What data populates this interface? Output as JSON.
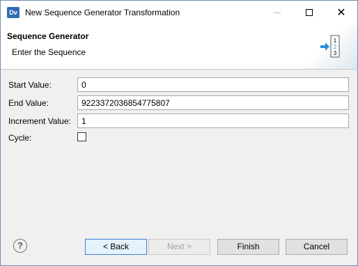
{
  "window": {
    "app_icon": "Dv",
    "title": "New Sequence Generator Transformation",
    "controls": {
      "minimize_icon": "minimize-icon",
      "maximize_icon": "maximize-icon",
      "close_icon": "close-icon",
      "close_glyph": "✕"
    }
  },
  "banner": {
    "title": "Sequence Generator",
    "subtitle": "Enter the Sequence",
    "icon": "sequence-generator-icon",
    "icon_digits": [
      "1",
      "2",
      "3"
    ]
  },
  "form": {
    "start_value": {
      "label": "Start Value:",
      "value": "0"
    },
    "end_value": {
      "label": "End Value:",
      "value": "9223372036854775807"
    },
    "increment_value": {
      "label": "Increment Value:",
      "value": "1"
    },
    "cycle": {
      "label": "Cycle:",
      "checked": false
    }
  },
  "footer": {
    "help_glyph": "?",
    "back_label": "< Back",
    "next_label": "Next >",
    "finish_label": "Finish",
    "cancel_label": "Cancel"
  }
}
